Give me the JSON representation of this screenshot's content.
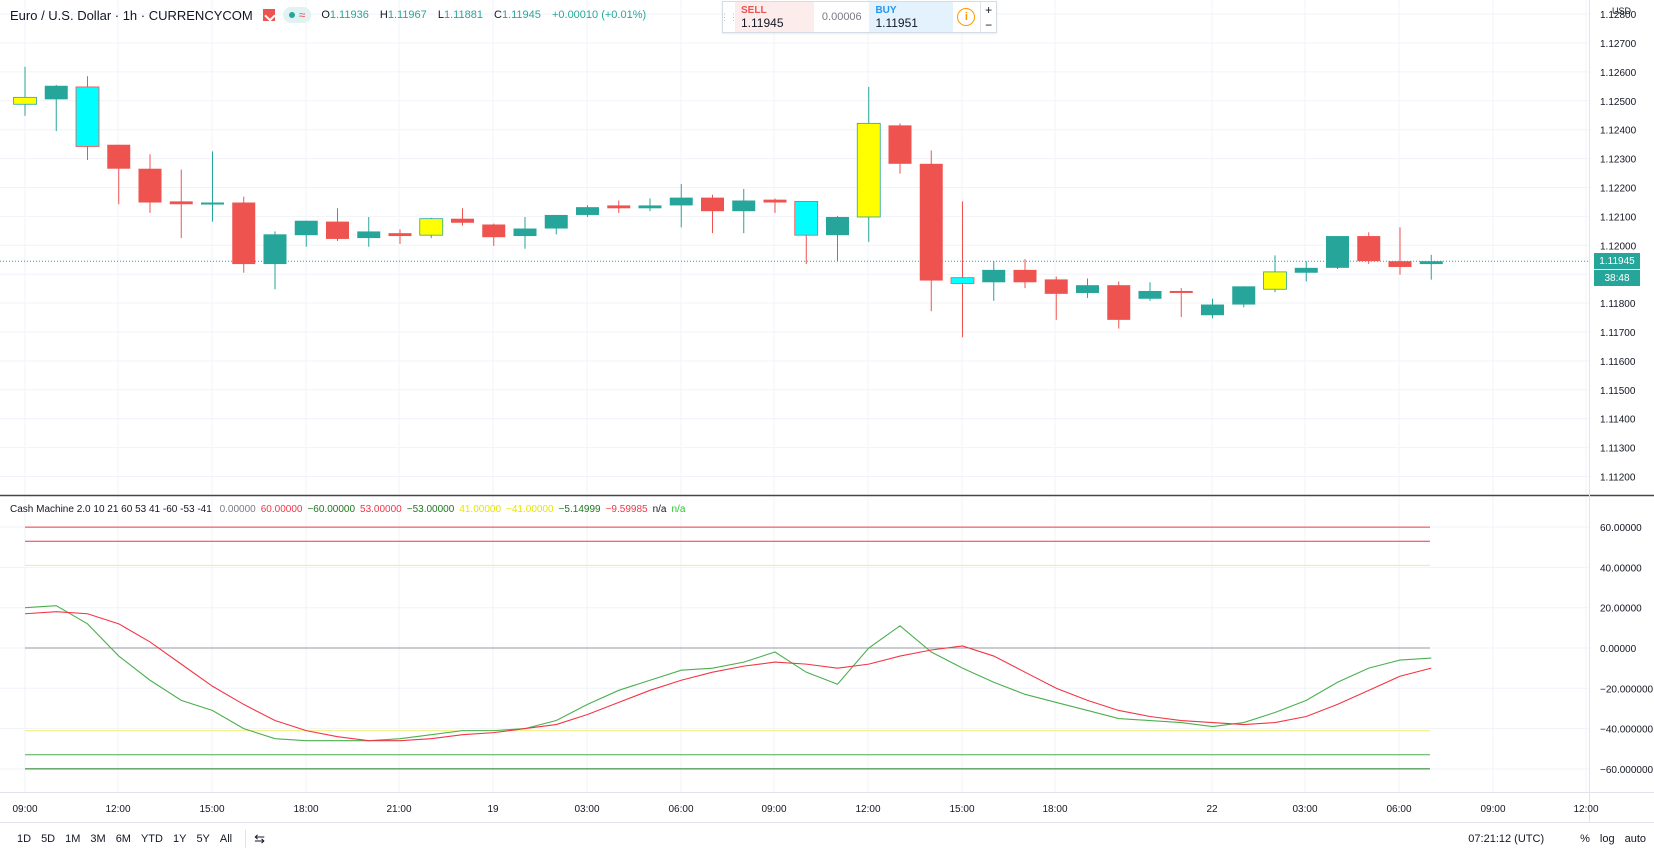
{
  "header": {
    "symbol_title": "Euro / U.S. Dollar · 1h · CURRENCYCOM",
    "ohlc": [
      {
        "k": "O",
        "v": "1.11936"
      },
      {
        "k": "H",
        "v": "1.11967"
      },
      {
        "k": "L",
        "v": "1.11881"
      },
      {
        "k": "C",
        "v": "1.11945"
      }
    ],
    "change": "+0.00010 (+0.01%)"
  },
  "trade_panel": {
    "sell_label": "SELL",
    "sell_price": "1.11945",
    "spread": "0.00006",
    "buy_label": "BUY",
    "buy_price": "1.11951",
    "info_glyph": "i",
    "plus": "+",
    "minus": "−"
  },
  "price_axis": {
    "currency": "USD",
    "current_price_label": "1.11945",
    "countdown_label": "38:48"
  },
  "indicator_legend": {
    "name": "Cash Machine 2.0 10 21 60 53 41 -60 -53 -41",
    "values": [
      {
        "text": "0.00000",
        "color": "#787b86"
      },
      {
        "text": "60.00000",
        "color": "#f23645"
      },
      {
        "text": "−60.00000",
        "color": "#1b7a1b"
      },
      {
        "text": "53.00000",
        "color": "#f23645"
      },
      {
        "text": "−53.00000",
        "color": "#1b7a1b"
      },
      {
        "text": "41.00000",
        "color": "#e6e600"
      },
      {
        "text": "−41.00000",
        "color": "#e6e600"
      },
      {
        "text": "−5.14999",
        "color": "#1b7a1b"
      },
      {
        "text": "−9.59985",
        "color": "#f23645"
      },
      {
        "text": "n/a",
        "color": "#131722"
      },
      {
        "text": "n/a",
        "color": "#26c926"
      }
    ]
  },
  "bottom_bar": {
    "ranges": [
      "1D",
      "5D",
      "1M",
      "3M",
      "6M",
      "YTD",
      "1Y",
      "5Y",
      "All"
    ],
    "goto_icon": "calendar-goto-icon",
    "time": "07:21:12 (UTC)",
    "percent": "%",
    "log": "log",
    "auto": "auto"
  },
  "colors": {
    "up": "#26a69a",
    "down": "#ef5350",
    "yellow": "#ffff00",
    "cyan": "#00ffff",
    "grid": "#f0f3fa"
  },
  "chart_data": [
    {
      "type": "candlestick",
      "title": "Euro / U.S. Dollar · 1h · CURRENCYCOM",
      "ylim": [
        1.1111,
        1.1281
      ],
      "y_ticks": [
        "1.11200",
        "1.11300",
        "1.11400",
        "1.11500",
        "1.11600",
        "1.11700",
        "1.11800",
        "1.11900",
        "1.12000",
        "1.12100",
        "1.12200",
        "1.12300",
        "1.12400",
        "1.12500",
        "1.12600",
        "1.12700",
        "1.12800"
      ],
      "x_ticks": [
        "09:00",
        "12:00",
        "15:00",
        "18:00",
        "21:00",
        "19",
        "03:00",
        "06:00",
        "09:00",
        "12:00",
        "15:00",
        "18:00",
        "22",
        "03:00",
        "06:00",
        "09:00",
        "12:00"
      ],
      "current_price": 1.11945,
      "candles": [
        {
          "o": 1.12488,
          "h": 1.12618,
          "l": 1.12448,
          "c": 1.12512,
          "color": "yellow"
        },
        {
          "o": 1.12505,
          "h": 1.12555,
          "l": 1.12395,
          "c": 1.12552,
          "color": "up"
        },
        {
          "o": 1.12548,
          "h": 1.12585,
          "l": 1.12295,
          "c": 1.12342,
          "color": "cyan"
        },
        {
          "o": 1.12348,
          "h": 1.12348,
          "l": 1.12142,
          "c": 1.12265,
          "color": "down"
        },
        {
          "o": 1.12265,
          "h": 1.12315,
          "l": 1.12112,
          "c": 1.12148,
          "color": "down"
        },
        {
          "o": 1.12152,
          "h": 1.12262,
          "l": 1.12025,
          "c": 1.12142,
          "color": "down"
        },
        {
          "o": 1.12142,
          "h": 1.12325,
          "l": 1.12082,
          "c": 1.12148,
          "color": "up"
        },
        {
          "o": 1.12148,
          "h": 1.12168,
          "l": 1.11905,
          "c": 1.11935,
          "color": "down"
        },
        {
          "o": 1.11935,
          "h": 1.12048,
          "l": 1.11848,
          "c": 1.12038,
          "color": "up"
        },
        {
          "o": 1.12035,
          "h": 1.12085,
          "l": 1.11995,
          "c": 1.12085,
          "color": "up"
        },
        {
          "o": 1.12082,
          "h": 1.12128,
          "l": 1.12015,
          "c": 1.12022,
          "color": "down"
        },
        {
          "o": 1.12025,
          "h": 1.12098,
          "l": 1.11995,
          "c": 1.12048,
          "color": "up"
        },
        {
          "o": 1.12042,
          "h": 1.12055,
          "l": 1.12005,
          "c": 1.12032,
          "color": "down"
        },
        {
          "o": 1.12035,
          "h": 1.12095,
          "l": 1.12025,
          "c": 1.12092,
          "color": "yellow"
        },
        {
          "o": 1.12092,
          "h": 1.12128,
          "l": 1.12068,
          "c": 1.12078,
          "color": "down"
        },
        {
          "o": 1.12072,
          "h": 1.12075,
          "l": 1.11998,
          "c": 1.12028,
          "color": "down"
        },
        {
          "o": 1.12032,
          "h": 1.12098,
          "l": 1.11988,
          "c": 1.12058,
          "color": "up"
        },
        {
          "o": 1.12058,
          "h": 1.12105,
          "l": 1.12038,
          "c": 1.12105,
          "color": "up"
        },
        {
          "o": 1.12105,
          "h": 1.12138,
          "l": 1.12098,
          "c": 1.12132,
          "color": "up"
        },
        {
          "o": 1.12138,
          "h": 1.12155,
          "l": 1.12112,
          "c": 1.12128,
          "color": "down"
        },
        {
          "o": 1.12128,
          "h": 1.12162,
          "l": 1.12118,
          "c": 1.12138,
          "color": "up"
        },
        {
          "o": 1.12138,
          "h": 1.12212,
          "l": 1.12062,
          "c": 1.12165,
          "color": "up"
        },
        {
          "o": 1.12165,
          "h": 1.12175,
          "l": 1.12042,
          "c": 1.12118,
          "color": "down"
        },
        {
          "o": 1.12118,
          "h": 1.12195,
          "l": 1.12042,
          "c": 1.12155,
          "color": "up"
        },
        {
          "o": 1.12158,
          "h": 1.12162,
          "l": 1.12112,
          "c": 1.12148,
          "color": "down"
        },
        {
          "o": 1.12152,
          "h": 1.12152,
          "l": 1.11935,
          "c": 1.12035,
          "color": "cyan"
        },
        {
          "o": 1.12035,
          "h": 1.12102,
          "l": 1.11945,
          "c": 1.12098,
          "color": "up"
        },
        {
          "o": 1.12098,
          "h": 1.12548,
          "l": 1.12012,
          "c": 1.12422,
          "color": "yellow"
        },
        {
          "o": 1.12415,
          "h": 1.12422,
          "l": 1.12248,
          "c": 1.12282,
          "color": "down"
        },
        {
          "o": 1.12282,
          "h": 1.12328,
          "l": 1.11772,
          "c": 1.11878,
          "color": "down"
        },
        {
          "o": 1.11888,
          "h": 1.12152,
          "l": 1.11682,
          "c": 1.11868,
          "color": "cyan"
        },
        {
          "o": 1.11872,
          "h": 1.11945,
          "l": 1.11808,
          "c": 1.11915,
          "color": "up"
        },
        {
          "o": 1.11915,
          "h": 1.11952,
          "l": 1.11852,
          "c": 1.11872,
          "color": "down"
        },
        {
          "o": 1.11882,
          "h": 1.11892,
          "l": 1.11742,
          "c": 1.11832,
          "color": "down"
        },
        {
          "o": 1.11835,
          "h": 1.11885,
          "l": 1.11818,
          "c": 1.11862,
          "color": "up"
        },
        {
          "o": 1.11862,
          "h": 1.11875,
          "l": 1.11712,
          "c": 1.11742,
          "color": "down"
        },
        {
          "o": 1.11815,
          "h": 1.11872,
          "l": 1.11808,
          "c": 1.11842,
          "color": "up"
        },
        {
          "o": 1.11842,
          "h": 1.11852,
          "l": 1.11752,
          "c": 1.11838,
          "color": "down"
        },
        {
          "o": 1.11758,
          "h": 1.11815,
          "l": 1.11748,
          "c": 1.11795,
          "color": "up"
        },
        {
          "o": 1.11795,
          "h": 1.11858,
          "l": 1.11785,
          "c": 1.11858,
          "color": "up"
        },
        {
          "o": 1.11848,
          "h": 1.11965,
          "l": 1.11838,
          "c": 1.11908,
          "color": "yellow"
        },
        {
          "o": 1.11905,
          "h": 1.11945,
          "l": 1.11875,
          "c": 1.11922,
          "color": "up"
        },
        {
          "o": 1.11922,
          "h": 1.12032,
          "l": 1.11918,
          "c": 1.12032,
          "color": "up"
        },
        {
          "o": 1.12032,
          "h": 1.12045,
          "l": 1.11935,
          "c": 1.11945,
          "color": "down"
        },
        {
          "o": 1.11945,
          "h": 1.12062,
          "l": 1.11898,
          "c": 1.11925,
          "color": "down"
        },
        {
          "o": 1.11935,
          "h": 1.11967,
          "l": 1.11881,
          "c": 1.11945,
          "color": "up"
        }
      ]
    },
    {
      "type": "line",
      "title": "Cash Machine 2.0 10 21 60 53 41 -60 -53 -41",
      "ylim": [
        -72,
        70
      ],
      "y_ticks": [
        "60.00000",
        "40.00000",
        "20.00000",
        "0.00000",
        "−20.000000",
        "−40.000000",
        "−60.000000"
      ],
      "levels": [
        {
          "value": 60,
          "color": "#f23645"
        },
        {
          "value": 53,
          "color": "#f23645"
        },
        {
          "value": 41,
          "color": "#f0f080"
        },
        {
          "value": 0,
          "color": "#9598a1"
        },
        {
          "value": -41,
          "color": "#f0f080"
        },
        {
          "value": -53,
          "color": "#4caf50"
        },
        {
          "value": -60,
          "color": "#1b7a1b"
        }
      ],
      "series": [
        {
          "color": "#4caf50",
          "values": [
            20,
            21,
            12,
            -4,
            -16,
            -26,
            -31,
            -40,
            -45,
            -46,
            -46,
            -46,
            -45,
            -43,
            -41,
            -41,
            -40,
            -36,
            -28,
            -21,
            -16,
            -11,
            -10,
            -7,
            -2,
            -12,
            -18,
            0,
            11,
            -2,
            -10,
            -17,
            -23,
            -27,
            -31,
            -35,
            -36,
            -37,
            -39,
            -37,
            -32,
            -26,
            -17,
            -10,
            -6,
            -5
          ]
        },
        {
          "color": "#f23645",
          "values": [
            17,
            18,
            17,
            12,
            3,
            -8,
            -19,
            -28,
            -36,
            -41,
            -44,
            -46,
            -46,
            -45,
            -43,
            -42,
            -40,
            -38,
            -33,
            -27,
            -21,
            -16,
            -12,
            -9,
            -7,
            -8,
            -10,
            -8,
            -4,
            -1,
            1,
            -4,
            -12,
            -20,
            -26,
            -31,
            -34,
            -36,
            -37,
            -38,
            -37,
            -34,
            -28,
            -21,
            -14,
            -10
          ]
        }
      ],
      "x_ticks": [
        "09:00",
        "12:00",
        "15:00",
        "18:00",
        "21:00",
        "19",
        "03:00",
        "06:00",
        "09:00",
        "12:00",
        "15:00",
        "18:00",
        "22",
        "03:00",
        "06:00",
        "09:00",
        "12:00"
      ]
    }
  ]
}
